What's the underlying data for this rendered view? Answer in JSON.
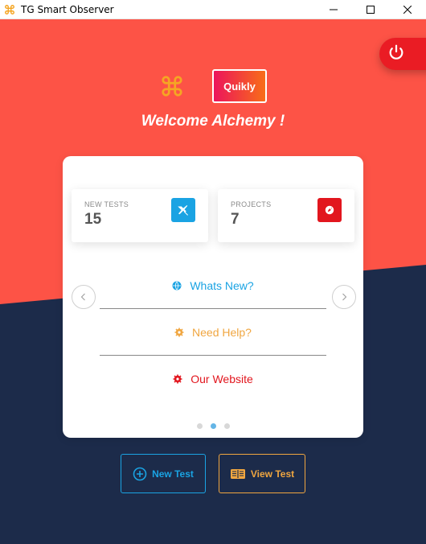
{
  "window": {
    "title": "TG Smart Observer"
  },
  "brand": {
    "badge": "Quikly",
    "welcome": "Welcome Alchemy !"
  },
  "stats": [
    {
      "label": "NEW TESTS",
      "value": "15",
      "icon": "tools-icon",
      "color": "#1aa3e3"
    },
    {
      "label": "PROJECTS",
      "value": "7",
      "icon": "rocket-icon",
      "color": "#e2161e"
    }
  ],
  "links": [
    {
      "label": "Whats New?",
      "icon": "globe-icon",
      "color": "#1aa3e3"
    },
    {
      "label": "Need Help?",
      "icon": "gear-icon",
      "color": "#f0a640"
    },
    {
      "label": "Our Website",
      "icon": "gear-icon",
      "color": "#e2161e"
    }
  ],
  "carousel": {
    "pages": 3,
    "active_index": 1
  },
  "actions": {
    "new_test": "New Test",
    "view_test": "View Test"
  },
  "colors": {
    "top_background": "#fd5346",
    "bottom_background": "#1c2b4a",
    "power": "#ea1c24"
  }
}
